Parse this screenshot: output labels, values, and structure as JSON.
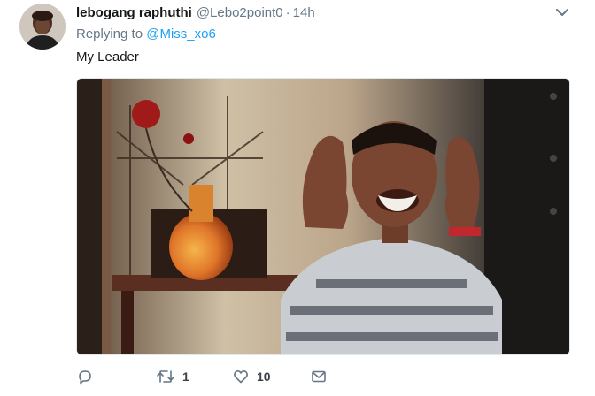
{
  "tweet": {
    "display_name": "lebogang raphuthi",
    "handle": "@Lebo2point0",
    "separator": "·",
    "time": "14h",
    "reply_prefix": "Replying to",
    "reply_to": "@Miss_xo6",
    "text": "My Leader",
    "media": {
      "type": "image",
      "icon": "video-still"
    },
    "actions": {
      "reply": {
        "icon": "reply-icon"
      },
      "retweet": {
        "icon": "retweet-icon",
        "count": "1"
      },
      "like": {
        "icon": "heart-icon",
        "count": "10"
      },
      "dm": {
        "icon": "envelope-icon"
      }
    },
    "menu": {
      "icon": "chevron-down-icon"
    }
  },
  "colors": {
    "text": "#14171a",
    "secondary": "#657786",
    "link": "#1da1f2",
    "border": "#e1e8ed"
  }
}
